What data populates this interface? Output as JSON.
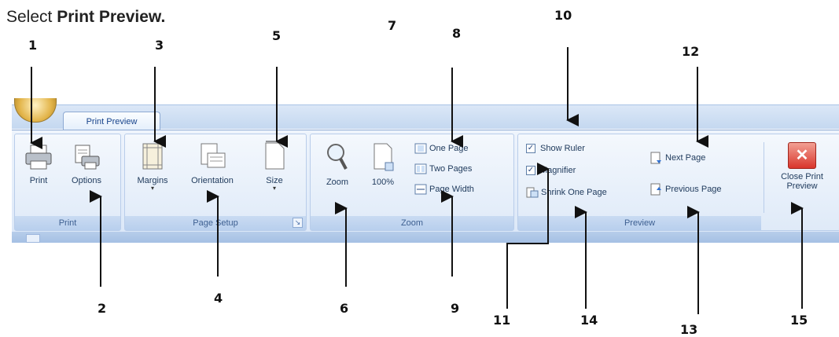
{
  "instruction": {
    "prefix": "Select ",
    "bold": "Print Preview."
  },
  "office_button": {
    "icon": "office-logo-icon"
  },
  "tab": {
    "label": "Print Preview"
  },
  "groups": {
    "print": {
      "label": "Print",
      "buttons": {
        "print": "Print",
        "options": "Options"
      }
    },
    "page_setup": {
      "label": "Page Setup",
      "buttons": {
        "margins": "Margins",
        "orientation": "Orientation",
        "size": "Size"
      }
    },
    "zoom": {
      "label": "Zoom",
      "buttons": {
        "zoom": "Zoom",
        "hundred": "100%",
        "one_page": "One Page",
        "two_pages": "Two Pages",
        "page_width": "Page Width"
      }
    },
    "preview": {
      "label": "Preview",
      "show_ruler": {
        "label": "Show Ruler",
        "checked": true
      },
      "magnifier": {
        "label": "Magnifier",
        "checked": true
      },
      "shrink": "Shrink One Page",
      "next_page": "Next Page",
      "previous_page": "Previous Page",
      "close_line1": "Close Print",
      "close_line2": "Preview"
    }
  },
  "callouts": [
    "1",
    "2",
    "3",
    "4",
    "5",
    "6",
    "7",
    "8",
    "9",
    "10",
    "11",
    "12",
    "13",
    "14",
    "15"
  ],
  "colors": {
    "ribbon_blue": "#dce8f8",
    "group_label": "#3d5f91",
    "close_red": "#d9352c"
  }
}
